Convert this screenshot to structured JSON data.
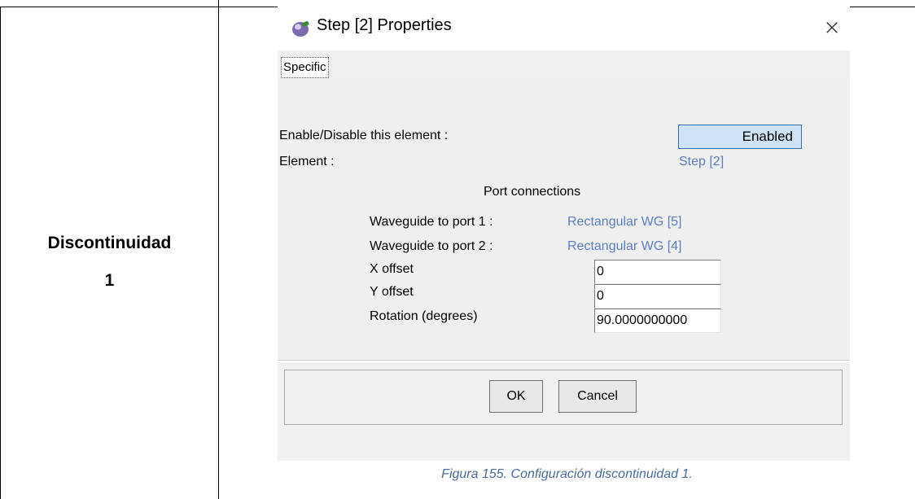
{
  "row_label": {
    "line1": "Discontinuidad",
    "line2": "1"
  },
  "dialog": {
    "title": "Step [2] Properties",
    "close_symbol": "×",
    "tab_label": "Specific",
    "enable_label": "Enable/Disable this element :",
    "enable_button": "Enabled",
    "element_label": "Element :",
    "element_value": "Step [2]",
    "port_connections_heading": "Port connections",
    "port1_label": "Waveguide to port 1 :",
    "port1_value": "Rectangular WG [5]",
    "port2_label": "Waveguide to port 2 :",
    "port2_value": "Rectangular WG [4]",
    "x_offset_label": "X offset",
    "x_offset_value": "0",
    "y_offset_label": "Y offset",
    "y_offset_value": "0",
    "rotation_label": "Rotation (degrees)",
    "rotation_value": "90.0000000000",
    "ok_label": "OK",
    "cancel_label": "Cancel"
  },
  "caption": "Figura 155. Configuración discontinuidad 1.",
  "colors": {
    "link_value": "#5b7fbf",
    "enabled_bg": "#cfe3f5",
    "caption": "#4a6a9a"
  },
  "icons": [
    "app-icon",
    "close-icon"
  ]
}
